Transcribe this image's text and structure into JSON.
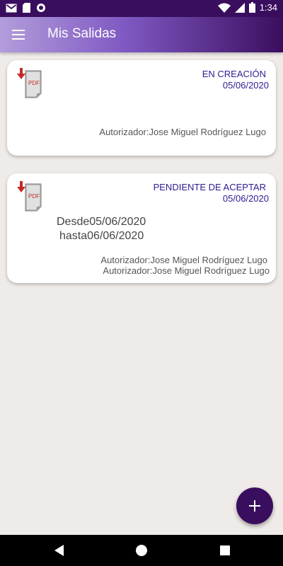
{
  "status_bar": {
    "time": "1:34",
    "left_icons": [
      "gmail-icon",
      "sd-card-icon",
      "circle-icon"
    ],
    "right_icons": [
      "wifi-icon",
      "signal-icon",
      "battery-icon"
    ]
  },
  "app_bar": {
    "title": "Mis Salidas",
    "menu_icon": "hamburger-menu-icon"
  },
  "cards": [
    {
      "status": "EN CREACIÓN",
      "date": "05/06/2020",
      "authorizers": [
        "Autorizador:Jose Miguel Rodríguez Lugo"
      ]
    },
    {
      "status": "PENDIENTE DE ACEPTAR",
      "date": "05/06/2020",
      "desde": "Desde05/06/2020",
      "hasta": "hasta06/06/2020",
      "authorizers": [
        "Autorizador:Jose Miguel Rodríguez Lugo",
        "Autorizador:Jose Miguel Rodríguez Lugo"
      ]
    }
  ],
  "fab": {
    "icon": "plus-icon"
  },
  "nav": {
    "icons": [
      "back-icon",
      "home-icon",
      "recents-icon"
    ]
  },
  "colors": {
    "primary": "#3a0e5e",
    "status_text": "#311b92",
    "pdf_arrow": "#c62828"
  }
}
